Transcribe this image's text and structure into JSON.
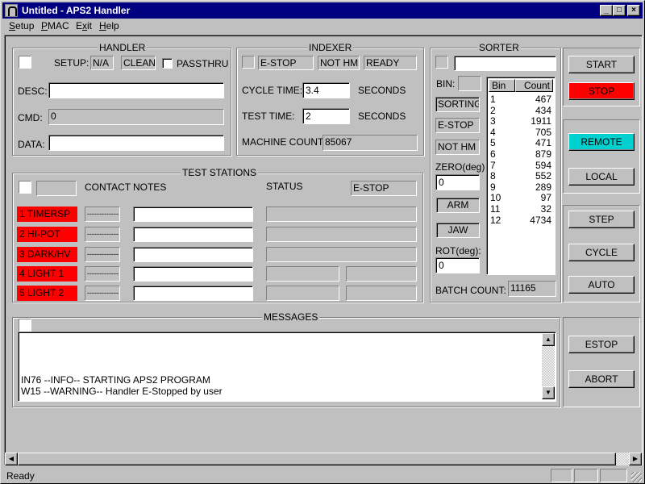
{
  "window": {
    "title": "Untitled - APS2 Handler",
    "minimize": "_",
    "maximize": "□",
    "close": "×"
  },
  "menu": [
    {
      "label": "Setup",
      "underline": "S",
      "rest": "etup"
    },
    {
      "label": "PMAC",
      "underline": "P",
      "rest": "MAC"
    },
    {
      "label": "Exit",
      "pre": "E",
      "underline": "x",
      "rest": "it"
    },
    {
      "label": "Help",
      "underline": "H",
      "rest": "elp"
    }
  ],
  "handler": {
    "title": "HANDLER",
    "setup_label": "SETUP:",
    "setup_value": "N/A",
    "clean_status": "CLEAN",
    "passthru_label": "PASSTHRU",
    "passthru_checked": false,
    "desc_label": "DESC:",
    "desc_value": "",
    "cmd_label": "CMD:",
    "cmd_value": "0",
    "data_label": "DATA:",
    "data_value": ""
  },
  "indexer": {
    "title": "INDEXER",
    "status1": "E-STOP",
    "status2": "NOT HM",
    "status3": "READY",
    "cycle_time_label": "CYCLE TIME:",
    "cycle_time_value": "3.4",
    "cycle_time_unit": "SECONDS",
    "test_time_label": "TEST TIME:",
    "test_time_value": "2",
    "test_time_unit": "SECONDS",
    "machine_count_label": "MACHINE COUNT:",
    "machine_count_value": "85067"
  },
  "sorter": {
    "title": "SORTER",
    "top_value": "",
    "bin_label": "BIN:",
    "bin_value": "",
    "sorting_status": "SORTING",
    "estop_status": "E-STOP",
    "nothm_status": "NOT HM",
    "zero_label": "ZERO(deg)",
    "zero_value": "0",
    "arm_label": "ARM",
    "jaw_label": "JAW",
    "rot_label": "ROT(deg):",
    "rot_value": "0",
    "batch_count_label": "BATCH COUNT:",
    "batch_count_value": "11165",
    "table_headers": [
      "Bin",
      "Count"
    ],
    "bins": [
      {
        "bin": "1",
        "count": "467"
      },
      {
        "bin": "2",
        "count": "434"
      },
      {
        "bin": "3",
        "count": "1911"
      },
      {
        "bin": "4",
        "count": "705"
      },
      {
        "bin": "5",
        "count": "471"
      },
      {
        "bin": "6",
        "count": "879"
      },
      {
        "bin": "7",
        "count": "594"
      },
      {
        "bin": "8",
        "count": "552"
      },
      {
        "bin": "9",
        "count": "289"
      },
      {
        "bin": "10",
        "count": "97"
      },
      {
        "bin": "11",
        "count": "32"
      },
      {
        "bin": "12",
        "count": "4734"
      }
    ]
  },
  "test_stations": {
    "title": "TEST STATIONS",
    "contact_header": "CONTACT",
    "notes_header": "NOTES",
    "status_header": "STATUS",
    "overall_status": "E-STOP",
    "stations": [
      {
        "name": "1  TIMERSP",
        "contact": "-------------",
        "notes": "",
        "status": ""
      },
      {
        "name": "2  HI-POT",
        "contact": "-------------",
        "notes": "",
        "status": ""
      },
      {
        "name": "3  DARK/HV",
        "contact": "-------------",
        "notes": "",
        "status": ""
      },
      {
        "name": "4  LIGHT 1",
        "contact": "-------------",
        "notes": "",
        "status": ""
      },
      {
        "name": "5  LIGHT 2",
        "contact": "-------------",
        "notes": "",
        "status": ""
      }
    ],
    "station_color": "#ff0000"
  },
  "controls": {
    "start": "START",
    "stop": "STOP",
    "remote": "REMOTE",
    "local": "LOCAL",
    "step": "STEP",
    "cycle": "CYCLE",
    "auto": "AUTO",
    "estop": "ESTOP",
    "abort": "ABORT"
  },
  "messages": {
    "title": "MESSAGES",
    "lines": [
      "IN76 --INFO-- STARTING APS2 PROGRAM",
      "W15 --WARNING-- Handler E-Stopped by user"
    ]
  },
  "statusbar": {
    "text": "Ready"
  }
}
